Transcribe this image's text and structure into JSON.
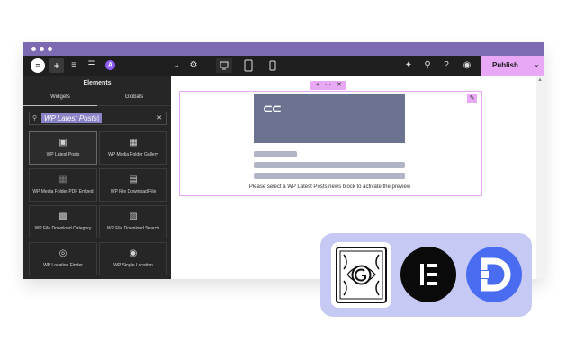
{
  "toolbar": {
    "publish_label": "Publish",
    "app_logo": "elementor-e-icon",
    "avatar_letter": "A"
  },
  "panel": {
    "title": "Elements",
    "tabs": [
      "Widgets",
      "Globals"
    ],
    "search_value": "WP Latest Posts|"
  },
  "widgets": [
    {
      "label": "WP Latest Posts",
      "icon": "posts-icon"
    },
    {
      "label": "WP Media Folder Gallery",
      "icon": "gallery-icon"
    },
    {
      "label": "WP Media Folder PDF Embed",
      "icon": "pdf-embed-icon"
    },
    {
      "label": "WP File Download File",
      "icon": "file-download-icon"
    },
    {
      "label": "WP File Download Category",
      "icon": "category-icon"
    },
    {
      "label": "WP File Download Search",
      "icon": "file-search-icon"
    },
    {
      "label": "WP Location Finder",
      "icon": "location-finder-icon"
    },
    {
      "label": "WP Single Location",
      "icon": "location-pin-icon"
    }
  ],
  "canvas": {
    "notice": "Please select a WP Latest Posts news block to activate the preview"
  },
  "colors": {
    "brand_purple": "#7c6bb3",
    "accent_pink": "#e9a8f5",
    "badge_bg": "#c7c9f5",
    "divi_blue": "#4a6cf0"
  }
}
